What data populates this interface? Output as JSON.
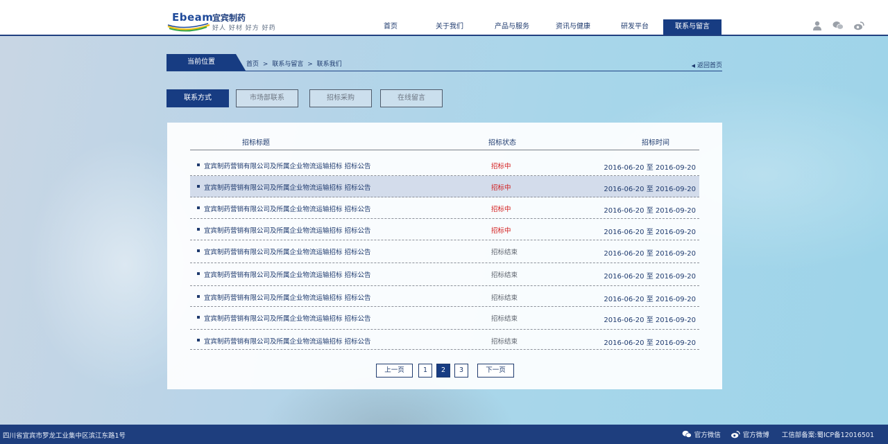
{
  "logo": {
    "en": "Ebeam",
    "cn": "宜宾制药",
    "slogan": "好人 好材  好方  好药"
  },
  "nav": {
    "items": [
      {
        "label": "首页"
      },
      {
        "label": "关于我们"
      },
      {
        "label": "产品与服务"
      },
      {
        "label": "资讯与健康"
      },
      {
        "label": "研发平台"
      },
      {
        "label": "联系与留言"
      }
    ],
    "active_index": 5
  },
  "header_icons": [
    "user-icon",
    "wechat-icon",
    "weibo-icon"
  ],
  "breadcrumb": {
    "label": "当前位置",
    "path": [
      "首页",
      ">",
      "联系与留言",
      ">",
      "联系我们"
    ],
    "back_home": "返回首页"
  },
  "subtabs": [
    {
      "label": "联系方式"
    },
    {
      "label": "市场部联系"
    },
    {
      "label": "招标采购"
    },
    {
      "label": "在线留言"
    }
  ],
  "table": {
    "headers": {
      "title": "招标标题",
      "status": "招标状态",
      "time": "招标时间"
    },
    "rows": [
      {
        "title": "宜宾制药营销有限公司及所属企业物流运输招标 招标公告",
        "status": "招标中",
        "time": "2016-06-20 至 2016-09-20"
      },
      {
        "title": "宜宾制药营销有限公司及所属企业物流运输招标 招标公告",
        "status": "招标中",
        "time": "2016-06-20 至 2016-09-20"
      },
      {
        "title": "宜宾制药营销有限公司及所属企业物流运输招标 招标公告",
        "status": "招标中",
        "time": "2016-06-20 至 2016-09-20"
      },
      {
        "title": "宜宾制药营销有限公司及所属企业物流运输招标 招标公告",
        "status": "招标中",
        "time": "2016-06-20 至 2016-09-20"
      },
      {
        "title": "宜宾制药营销有限公司及所属企业物流运输招标 招标公告",
        "status": "招标结束",
        "time": "2016-06-20 至 2016-09-20"
      },
      {
        "title": "宜宾制药营销有限公司及所属企业物流运输招标 招标公告",
        "status": "招标结束",
        "time": "2016-06-20 至 2016-09-20"
      },
      {
        "title": "宜宾制药营销有限公司及所属企业物流运输招标 招标公告",
        "status": "招标结束",
        "time": "2016-06-20 至 2016-09-20"
      },
      {
        "title": "宜宾制药营销有限公司及所属企业物流运输招标 招标公告",
        "status": "招标结束",
        "time": "2016-06-20 至 2016-09-20"
      },
      {
        "title": "宜宾制药营销有限公司及所属企业物流运输招标 招标公告",
        "status": "招标结束",
        "time": "2016-06-20 至 2016-09-20"
      }
    ]
  },
  "pagination": {
    "prev": "上一页",
    "pages": [
      "1",
      "2",
      "3"
    ],
    "current": "2",
    "next": "下一页"
  },
  "footer": {
    "address": "四川省宜宾市罗龙工业集中区滨江东路1号",
    "wechat": "官方微信",
    "weibo": "官方微博",
    "icp": "工信部备案:蜀ICP备12016501"
  },
  "colors": {
    "primary": "#173c82",
    "active_status": "#d21a1a",
    "ended_status": "#5e646e"
  }
}
